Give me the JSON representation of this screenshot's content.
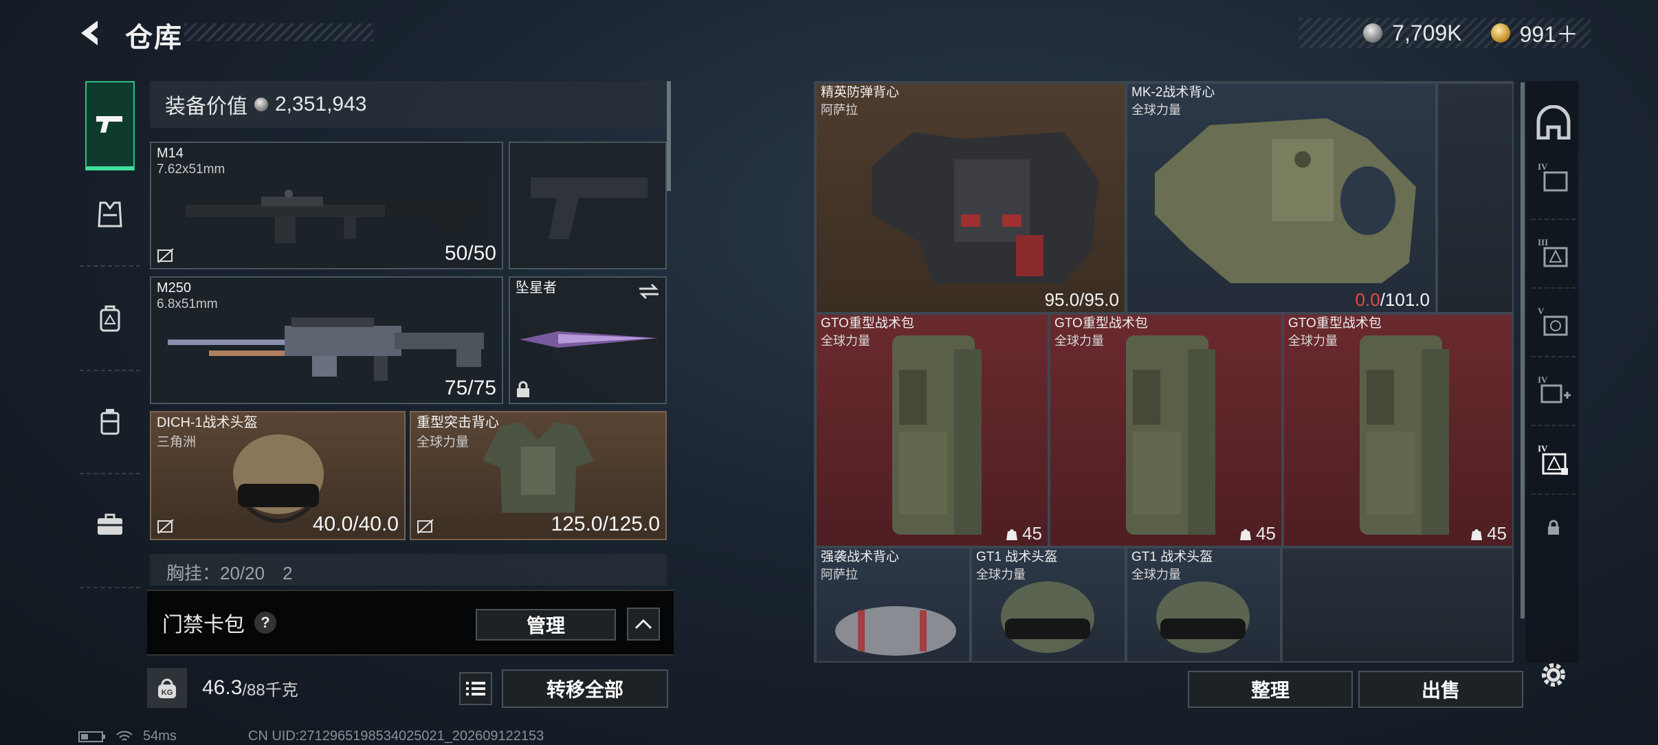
{
  "header": {
    "title": "仓库",
    "silver_amount": "7,709K",
    "gold_amount": "991＋"
  },
  "loadout": {
    "value_label": "装备价值",
    "value_amount": "2,351,943",
    "primary": {
      "name": "M14",
      "ammo": "7.62x51mm",
      "count": "50/50"
    },
    "secondary": {
      "name": "M250",
      "ammo": "6.8x51mm",
      "count": "75/75"
    },
    "melee": {
      "name": "坠星者"
    },
    "helmet": {
      "name": "DICH-1战术头盔",
      "brand": "三角洲",
      "durability": "40.0/40.0"
    },
    "armor": {
      "name": "重型突击背心",
      "brand": "全球力量",
      "durability": "125.0/125.0"
    },
    "chest_rig_partial": "胸挂：20/20　2"
  },
  "keycard": {
    "label": "门禁卡包",
    "help": "?",
    "manage_button": "管理"
  },
  "weight": {
    "current": "46.3",
    "max": "/88千克",
    "transfer_all_button": "转移全部"
  },
  "storage": {
    "items": [
      {
        "name": "精英防弹背心",
        "brand": "阿萨拉",
        "durability": "95.0/95.0"
      },
      {
        "name": "MK-2战术背心",
        "brand": "全球力量",
        "durability_current": "0.0",
        "durability_max": "/101.0"
      },
      {
        "name": "GTO重型战术包",
        "brand": "全球力量",
        "qty": "45"
      },
      {
        "name": "GTO重型战术包",
        "brand": "全球力量",
        "qty": "45"
      },
      {
        "name": "GTO重型战术包",
        "brand": "全球力量",
        "qty": "45"
      },
      {
        "name": "强袭战术背心",
        "brand": "阿萨拉"
      },
      {
        "name": "GT1 战术头盔",
        "brand": "全球力量"
      },
      {
        "name": "GT1 战术头盔",
        "brand": "全球力量"
      }
    ],
    "sort_button": "整理",
    "sell_button": "出售"
  },
  "status_bar": {
    "ping": "54ms",
    "uid": "CN UID:2712965198534025021_202609122153"
  },
  "colors": {
    "accent_green": "#3fe09a",
    "durability_zero": "#e84848"
  }
}
